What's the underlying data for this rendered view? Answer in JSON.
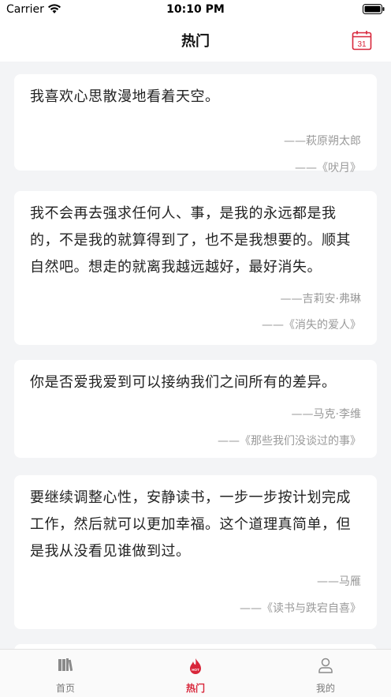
{
  "status_bar": {
    "carrier": "Carrier",
    "time": "10:10 PM"
  },
  "nav": {
    "title": "热门",
    "calendar_day": "31"
  },
  "quotes": [
    {
      "text": "我喜欢心思散漫地看着天空。",
      "author": "——萩原朔太郎",
      "source": "——《吠月》"
    },
    {
      "text": "我不会再去强求任何人、事，是我的永远都是我的，不是我的就算得到了，也不是我想要的。顺其自然吧。想走的就离我越远越好，最好消失。",
      "author": "——吉莉安·弗琳",
      "source": "——《消失的爱人》"
    },
    {
      "text": "你是否爱我爱到可以接纳我们之间所有的差异。",
      "author": "——马克·李维",
      "source": "——《那些我们没谈过的事》"
    },
    {
      "text": "要继续调整心性，安静读书，一步一步按计划完成工作，然后就可以更加幸福。这个道理真简单，但是我从没看见谁做到过。",
      "author": "——马雁",
      "source": "——《读书与跌宕自喜》"
    }
  ],
  "tabs": [
    {
      "label": "首页",
      "icon": "books-icon",
      "active": false
    },
    {
      "label": "热门",
      "icon": "fire-hot-icon",
      "active": true,
      "badge": "HOT"
    },
    {
      "label": "我的",
      "icon": "user-icon",
      "active": false
    }
  ],
  "colors": {
    "accent": "#d8263a",
    "inactive": "#7a7a7a",
    "meta": "#9a9a9a"
  }
}
